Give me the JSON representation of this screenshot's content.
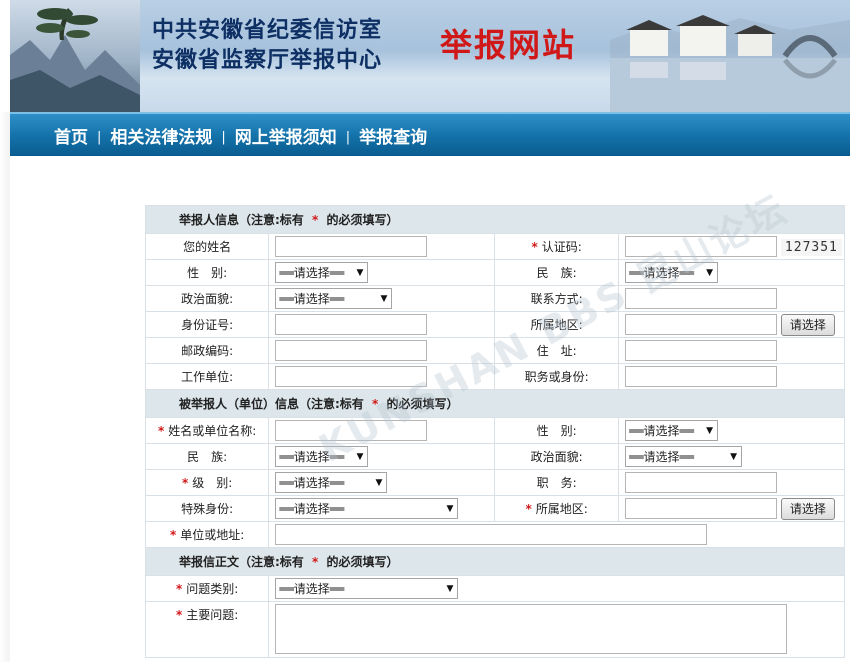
{
  "banner": {
    "line1": "中共安徽省纪委信访室",
    "line2": "安徽省监察厅举报中心",
    "site_name": "举报网站"
  },
  "nav": {
    "items": [
      "首页",
      "相关法律法规",
      "网上举报须知",
      "举报查询"
    ],
    "separator": "|"
  },
  "form": {
    "reporter_section": {
      "title": "举报人信息（注意:标有",
      "required_mark": "*",
      "suffix": "的必须填写）"
    },
    "reporter": {
      "name_label": "您的姓名",
      "captcha_label": "认证码:",
      "captcha_value": "127351",
      "gender_label": "性　别:",
      "ethnicity_label": "民　族:",
      "political_label": "政治面貌:",
      "contact_label": "联系方式:",
      "id_label": "身份证号:",
      "region_label": "所属地区:",
      "postcode_label": "邮政编码:",
      "address_label": "住　址:",
      "employer_label": "工作单位:",
      "position_label": "职务或身份:"
    },
    "accused_section": {
      "title": "被举报人（单位）信息（注意:标有",
      "required_mark": "*",
      "suffix": "的必须填写）"
    },
    "accused": {
      "name_label": "姓名或单位名称:",
      "gender_label": "性　别:",
      "ethnicity_label": "民　族:",
      "political_label": "政治面貌:",
      "level_label": "级　别:",
      "duty_label": "职　务:",
      "special_label": "特殊身份:",
      "region_label": "所属地区:",
      "address_label": "单位或地址:"
    },
    "letter_section": {
      "title": "举报信正文（注意:标有",
      "required_mark": "*",
      "suffix": "的必须填写）"
    },
    "letter": {
      "category_label": "问题类别:",
      "main_issue_label": "主要问题:"
    },
    "select_placeholder": "══请选择══",
    "choose_button": "请选择"
  },
  "watermark": "KUNSHAN BBS 昆山论坛",
  "colors": {
    "nav_bg": "#1371a8",
    "section_bg": "#dde6ea",
    "required": "#d01818",
    "site_name": "#d01818",
    "title_text": "#0d2f63"
  }
}
